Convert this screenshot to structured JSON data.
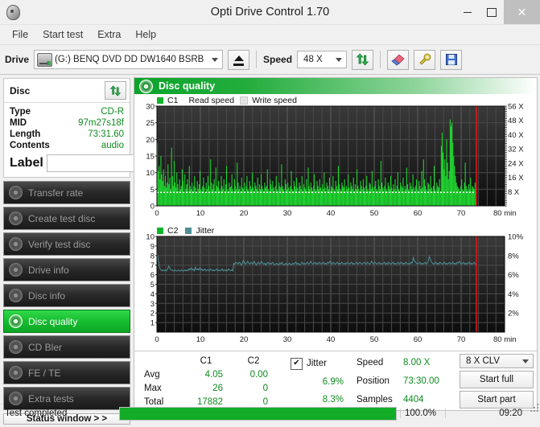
{
  "window": {
    "title": "Opti Drive Control 1.70",
    "icon": "disc-icon",
    "minimize": "–",
    "maximize": "□",
    "close": "×"
  },
  "menu": {
    "items": [
      "File",
      "Start test",
      "Extra",
      "Help"
    ]
  },
  "toolbar": {
    "drive_label": "Drive",
    "drive_value": "(G:)   BENQ DVD DD DW1640 BSRB",
    "eject_icon": "eject-icon",
    "speed_label": "Speed",
    "speed_value": "48 X",
    "refresh_icon": "refresh-arrows-icon",
    "erase_icon": "eraser-icon",
    "tools_icon": "tools-icon",
    "save_icon": "floppy-save-icon"
  },
  "disc_panel": {
    "title": "Disc",
    "refresh_icon": "refresh-arrows-icon",
    "rows": [
      {
        "key": "Type",
        "value": "CD-R"
      },
      {
        "key": "MID",
        "value": "97m27s18f"
      },
      {
        "key": "Length",
        "value": "73:31.60"
      },
      {
        "key": "Contents",
        "value": "audio"
      }
    ],
    "label_key": "Label",
    "label_value": "",
    "label_placeholder": "",
    "cd_button_icon": "cd-disc-icon"
  },
  "sidebar": {
    "items": [
      {
        "label": "Transfer rate",
        "icon": "disc-test-icon",
        "active": false
      },
      {
        "label": "Create test disc",
        "icon": "disc-burn-icon",
        "active": false
      },
      {
        "label": "Verify test disc",
        "icon": "disc-verify-icon",
        "active": false
      },
      {
        "label": "Drive info",
        "icon": "drive-info-icon",
        "active": false
      },
      {
        "label": "Disc info",
        "icon": "disc-info-icon",
        "active": false
      },
      {
        "label": "Disc quality",
        "icon": "disc-quality-icon",
        "active": true
      },
      {
        "label": "CD Bler",
        "icon": "cd-bler-icon",
        "active": false
      },
      {
        "label": "FE / TE",
        "icon": "fe-te-icon",
        "active": false
      },
      {
        "label": "Extra tests",
        "icon": "extra-tests-icon",
        "active": false
      }
    ],
    "status_window_button": "Status window > >"
  },
  "panel": {
    "title": "Disc quality",
    "icon": "disc-quality-icon"
  },
  "stats": {
    "col_headers": [
      "C1",
      "C2"
    ],
    "row_labels": [
      "Avg",
      "Max",
      "Total"
    ],
    "c1": {
      "avg": "4.05",
      "max": "26",
      "total": "17882"
    },
    "c2": {
      "avg": "0.00",
      "max": "0",
      "total": "0"
    },
    "jitter": {
      "checked": true,
      "check_glyph": "✔",
      "header": "Jitter",
      "avg": "6.9%",
      "max": "8.3%"
    },
    "readouts": [
      {
        "key": "Speed",
        "value": "8.00 X"
      },
      {
        "key": "Position",
        "value": "73:30.00"
      },
      {
        "key": "Samples",
        "value": "4404"
      }
    ],
    "write_strategy": "8 X CLV",
    "start_full": "Start full",
    "start_part": "Start part"
  },
  "statusbar": {
    "text": "Test completed",
    "progress_percent": 100,
    "percent_label": "100.0%",
    "elapsed": "09:20"
  },
  "colors": {
    "c1_green": "#1fd32f",
    "jitter_teal": "#4f8f96",
    "accent_green": "#0ba32a",
    "marker_red": "#e81414",
    "chart_bg_top": "#3a3a3a",
    "chart_bg_bottom": "#0d0d0d"
  },
  "chart_data": [
    {
      "type": "bar",
      "name": "C1 error rate",
      "title": "C1 / Read speed / Write speed",
      "legend": [
        {
          "label": "C1",
          "color": "#11b52a"
        },
        {
          "label": "Read speed",
          "color": "#cfcfcf"
        },
        {
          "label": "Write speed",
          "color": "#e8e8e8"
        }
      ],
      "legend_position": "top-left",
      "xlabel": "min",
      "xlim": [
        0,
        80
      ],
      "xticks": [
        0,
        10,
        20,
        30,
        40,
        50,
        60,
        70,
        80
      ],
      "xtick_labels": [
        "0",
        "10",
        "20",
        "30",
        "40",
        "50",
        "60",
        "70",
        "80 min"
      ],
      "ylabel": "",
      "ylim": [
        0,
        30
      ],
      "yticks": [
        0,
        5,
        10,
        15,
        20,
        25,
        30
      ],
      "y2label": "X",
      "y2lim": [
        0,
        56
      ],
      "y2ticks": [
        8,
        16,
        24,
        32,
        40,
        48,
        56
      ],
      "y2tick_labels": [
        "8 X",
        "16 X",
        "24 X",
        "32 X",
        "40 X",
        "48 X",
        "56 X"
      ],
      "grid": true,
      "average_line": 4.05,
      "average_line_style": "dotted-white",
      "end_marker_x": 73.5,
      "data_end_x": 73.5,
      "values": [
        19.0,
        10.5,
        12.0,
        8.0,
        15.0,
        9.5,
        7.5,
        11.0,
        6.0,
        9.0,
        5.5,
        7.0,
        12.5,
        6.5,
        8.5,
        5.0,
        17.5,
        9.0,
        6.0,
        13.5,
        7.0,
        5.5,
        10.0,
        6.5,
        4.5,
        8.0,
        5.0,
        6.0,
        11.0,
        7.5,
        4.0,
        9.5,
        5.0,
        6.5,
        8.0,
        4.5,
        12.0,
        6.0,
        5.0,
        7.0,
        4.5,
        6.0,
        9.0,
        5.5,
        4.0,
        7.5,
        5.0,
        6.5,
        10.5,
        5.0,
        4.5,
        6.0,
        8.5,
        5.5,
        4.0,
        7.0,
        5.0,
        9.0,
        6.0,
        4.5,
        14.0,
        7.0,
        5.0,
        6.5,
        8.0,
        4.5,
        11.5,
        6.0,
        5.5,
        7.5,
        5.0,
        4.5,
        9.0,
        6.0,
        5.0,
        8.0,
        4.5,
        6.5,
        12.0,
        5.0,
        4.5,
        7.0,
        5.5,
        6.0,
        9.5,
        5.0,
        4.5,
        8.0,
        6.0,
        5.0,
        13.0,
        7.0,
        5.0,
        6.0,
        4.5,
        8.5,
        5.5,
        5.0,
        7.0,
        4.5,
        6.0,
        9.0,
        5.0,
        4.5,
        7.5,
        6.0,
        5.0,
        10.0,
        5.5,
        4.5,
        7.0,
        6.0,
        5.0,
        8.5,
        4.5,
        6.5,
        5.0,
        9.5,
        6.0,
        5.0,
        4.5,
        7.0,
        5.5,
        6.0,
        11.0,
        5.0,
        4.5,
        8.0,
        6.5,
        5.0,
        7.5,
        5.5,
        4.5,
        6.0,
        9.0,
        5.0,
        4.5,
        7.0,
        6.0,
        5.5,
        12.5,
        6.0,
        5.0,
        4.5,
        8.0,
        6.5,
        5.0,
        7.0,
        5.5,
        4.5,
        6.0,
        10.5,
        5.0,
        4.5,
        7.5,
        6.0,
        5.0,
        8.5,
        5.5,
        4.5,
        7.0,
        6.0,
        5.0,
        9.0,
        4.5,
        6.5,
        5.5,
        5.0,
        8.0,
        4.5,
        11.5,
        6.0,
        5.0,
        7.0,
        5.5,
        4.5,
        6.0,
        9.5,
        5.0,
        4.5,
        7.5,
        6.0,
        5.0,
        8.0,
        5.5,
        4.5,
        6.5,
        5.0,
        10.0,
        5.5,
        4.5,
        7.0,
        6.0,
        5.0,
        8.5,
        4.5,
        6.0,
        5.5,
        9.0,
        5.0,
        4.5,
        7.5,
        6.0,
        5.0,
        12.0,
        6.5,
        5.0,
        4.5,
        7.0,
        6.0,
        5.5,
        8.0,
        4.5,
        6.0,
        5.0,
        9.5,
        5.5,
        4.5,
        7.0,
        6.0,
        5.0,
        8.5,
        4.5,
        6.5,
        5.0,
        11.0,
        6.0,
        5.0,
        4.5,
        7.5,
        6.0,
        5.0,
        8.0,
        5.5,
        4.5,
        6.0,
        9.0,
        5.0,
        4.5,
        7.0,
        6.5,
        5.0,
        10.5,
        5.5,
        4.5,
        6.0,
        7.5,
        5.0,
        4.5,
        8.0,
        6.0,
        5.0,
        13.5,
        7.0,
        5.5,
        4.5,
        6.0,
        8.5,
        5.0,
        4.5,
        7.0,
        6.0,
        5.0,
        9.0,
        5.5,
        4.5,
        6.5,
        5.0,
        8.0,
        4.5,
        6.0,
        10.0,
        5.0,
        4.5,
        7.0,
        6.0,
        5.5,
        8.5,
        4.5,
        6.0,
        5.0,
        11.5,
        6.5,
        5.0,
        4.5,
        7.0,
        6.0,
        5.0,
        9.5,
        5.5,
        4.5,
        6.0,
        8.0,
        5.0,
        4.5,
        7.5,
        6.0,
        5.0,
        10.5,
        5.5,
        14.0,
        8.0,
        6.0,
        5.0,
        4.5,
        7.0,
        6.5,
        5.0,
        9.0,
        5.5,
        4.5,
        6.0,
        12.0,
        5.0,
        4.5,
        7.0,
        6.0,
        5.5,
        8.0,
        4.5,
        18.0,
        22.0,
        16.0,
        11.0,
        14.0,
        9.0,
        20.0,
        13.0,
        8.0,
        10.5,
        26.0,
        24.0,
        25.0,
        19.0,
        15.0,
        12.0,
        9.0,
        7.0,
        6.0,
        5.5,
        5.0,
        4.5,
        6.0,
        8.0,
        5.0,
        4.5,
        7.0,
        13.0,
        6.0,
        5.0,
        4.5,
        6.5,
        5.0,
        8.5,
        4.5,
        6.0,
        5.5,
        5.0,
        7.0,
        4.5
      ]
    },
    {
      "type": "line",
      "name": "Jitter",
      "title": "C2 / Jitter",
      "legend": [
        {
          "label": "C2",
          "color": "#11b52a"
        },
        {
          "label": "Jitter",
          "color": "#4f8f96"
        }
      ],
      "legend_position": "top-left",
      "xlabel": "min",
      "xlim": [
        0,
        80
      ],
      "xticks": [
        0,
        10,
        20,
        30,
        40,
        50,
        60,
        70,
        80
      ],
      "xtick_labels": [
        "0",
        "10",
        "20",
        "30",
        "40",
        "50",
        "60",
        "70",
        "80 min"
      ],
      "ylim": [
        0,
        10
      ],
      "yticks": [
        1,
        2,
        3,
        4,
        5,
        6,
        7,
        8,
        9,
        10
      ],
      "y2label": "%",
      "y2lim": [
        0,
        10
      ],
      "y2ticks": [
        2,
        4,
        6,
        8,
        10
      ],
      "y2tick_labels": [
        "2%",
        "4%",
        "6%",
        "8%",
        "10%"
      ],
      "grid": true,
      "end_marker_x": 73.5,
      "data_end_x": 73.5,
      "series": [
        {
          "name": "Jitter",
          "color": "#4f8f96",
          "values": [
            8.3,
            7.8,
            7.0,
            6.6,
            6.5,
            6.4,
            6.5,
            6.4,
            6.5,
            6.4,
            6.6,
            6.9,
            6.7,
            6.5,
            6.5,
            6.4,
            6.4,
            6.5,
            6.4,
            6.4,
            6.5,
            6.4,
            6.4,
            6.5,
            6.4,
            6.4,
            6.5,
            6.4,
            6.5,
            6.4,
            6.6,
            6.5,
            6.7,
            6.5,
            6.6,
            6.4,
            6.8,
            6.5,
            6.6,
            6.5,
            6.7,
            6.5,
            6.6,
            6.4,
            6.5,
            6.6,
            6.4,
            6.5,
            6.5,
            6.4,
            6.6,
            6.5,
            6.4,
            6.5,
            6.4,
            6.5,
            6.6,
            6.4,
            6.5,
            6.4,
            6.5,
            6.6,
            6.4,
            6.5,
            6.4,
            6.5,
            6.4,
            6.6,
            6.5,
            6.4,
            6.5,
            6.4,
            7.2,
            7.1,
            7.3,
            7.2,
            7.1,
            7.3,
            7.2,
            7.0,
            7.2,
            7.5,
            7.3,
            7.1,
            7.2,
            7.4,
            7.2,
            7.1,
            7.3,
            7.2,
            7.1,
            7.4,
            7.2,
            7.0,
            7.2,
            7.3,
            7.1,
            7.2,
            7.4,
            7.2,
            7.1,
            7.2,
            7.0,
            7.2,
            7.3,
            7.1,
            7.2,
            7.1,
            7.3,
            7.2,
            7.0,
            7.1,
            7.2,
            7.1,
            7.0,
            7.2,
            7.1,
            7.3,
            7.1,
            7.0,
            7.1,
            7.2,
            7.0,
            7.1,
            7.2,
            7.1,
            7.0,
            7.2,
            7.1,
            7.2,
            7.3,
            7.1,
            7.2,
            7.1,
            7.0,
            7.2,
            7.3,
            7.1,
            7.2,
            7.1,
            7.2,
            7.3,
            7.1,
            7.2,
            7.4,
            7.2,
            7.1,
            7.2,
            7.3,
            7.1,
            7.2,
            7.1,
            7.3,
            7.2,
            7.1,
            7.2,
            7.3,
            7.1,
            7.2,
            7.1,
            7.3,
            7.2,
            7.4,
            7.2,
            7.1,
            7.3,
            7.2,
            7.1,
            7.2,
            7.3,
            7.1,
            7.2,
            7.1,
            7.3,
            7.2,
            7.1,
            7.2,
            7.1,
            7.3,
            7.2,
            7.1,
            7.2,
            7.3,
            7.1,
            7.2,
            7.1,
            7.2,
            7.3,
            7.1,
            7.2,
            7.3,
            7.2,
            7.1,
            7.2,
            7.3,
            7.2,
            7.1,
            7.3,
            7.2,
            7.1,
            7.2,
            7.4,
            7.2,
            7.1,
            7.3,
            7.2,
            7.1,
            7.2,
            7.3,
            7.1,
            7.2,
            7.1,
            7.2,
            7.3,
            7.1,
            7.2,
            7.1,
            7.3,
            7.2,
            7.1,
            7.2,
            7.3,
            7.1,
            7.2,
            7.1,
            7.2,
            7.3,
            7.1,
            7.2,
            7.3,
            7.1,
            7.2,
            7.1,
            7.3,
            7.2,
            7.1,
            7.2,
            7.1,
            7.3,
            7.2,
            7.8,
            7.5,
            7.3,
            7.2,
            7.1,
            7.2,
            7.3,
            7.1,
            7.2,
            7.1,
            7.2,
            7.3,
            7.1,
            7.2,
            7.4,
            7.9,
            7.6,
            7.3,
            7.2,
            7.1,
            7.2,
            7.3,
            7.1,
            7.2,
            7.1,
            7.3,
            7.2,
            7.1,
            7.2,
            7.3,
            7.1,
            7.2,
            7.1,
            7.2,
            7.3,
            7.1,
            7.2,
            7.3,
            7.1,
            7.2,
            7.1,
            7.3,
            7.2,
            7.4,
            7.2,
            7.1,
            7.2,
            7.3,
            7.1,
            7.2,
            7.1,
            7.2,
            7.3,
            7.1,
            7.2,
            7.1,
            7.2,
            7.3,
            7.1,
            7.2
          ]
        },
        {
          "name": "C2",
          "color": "#11b52a",
          "values": []
        }
      ]
    }
  ]
}
